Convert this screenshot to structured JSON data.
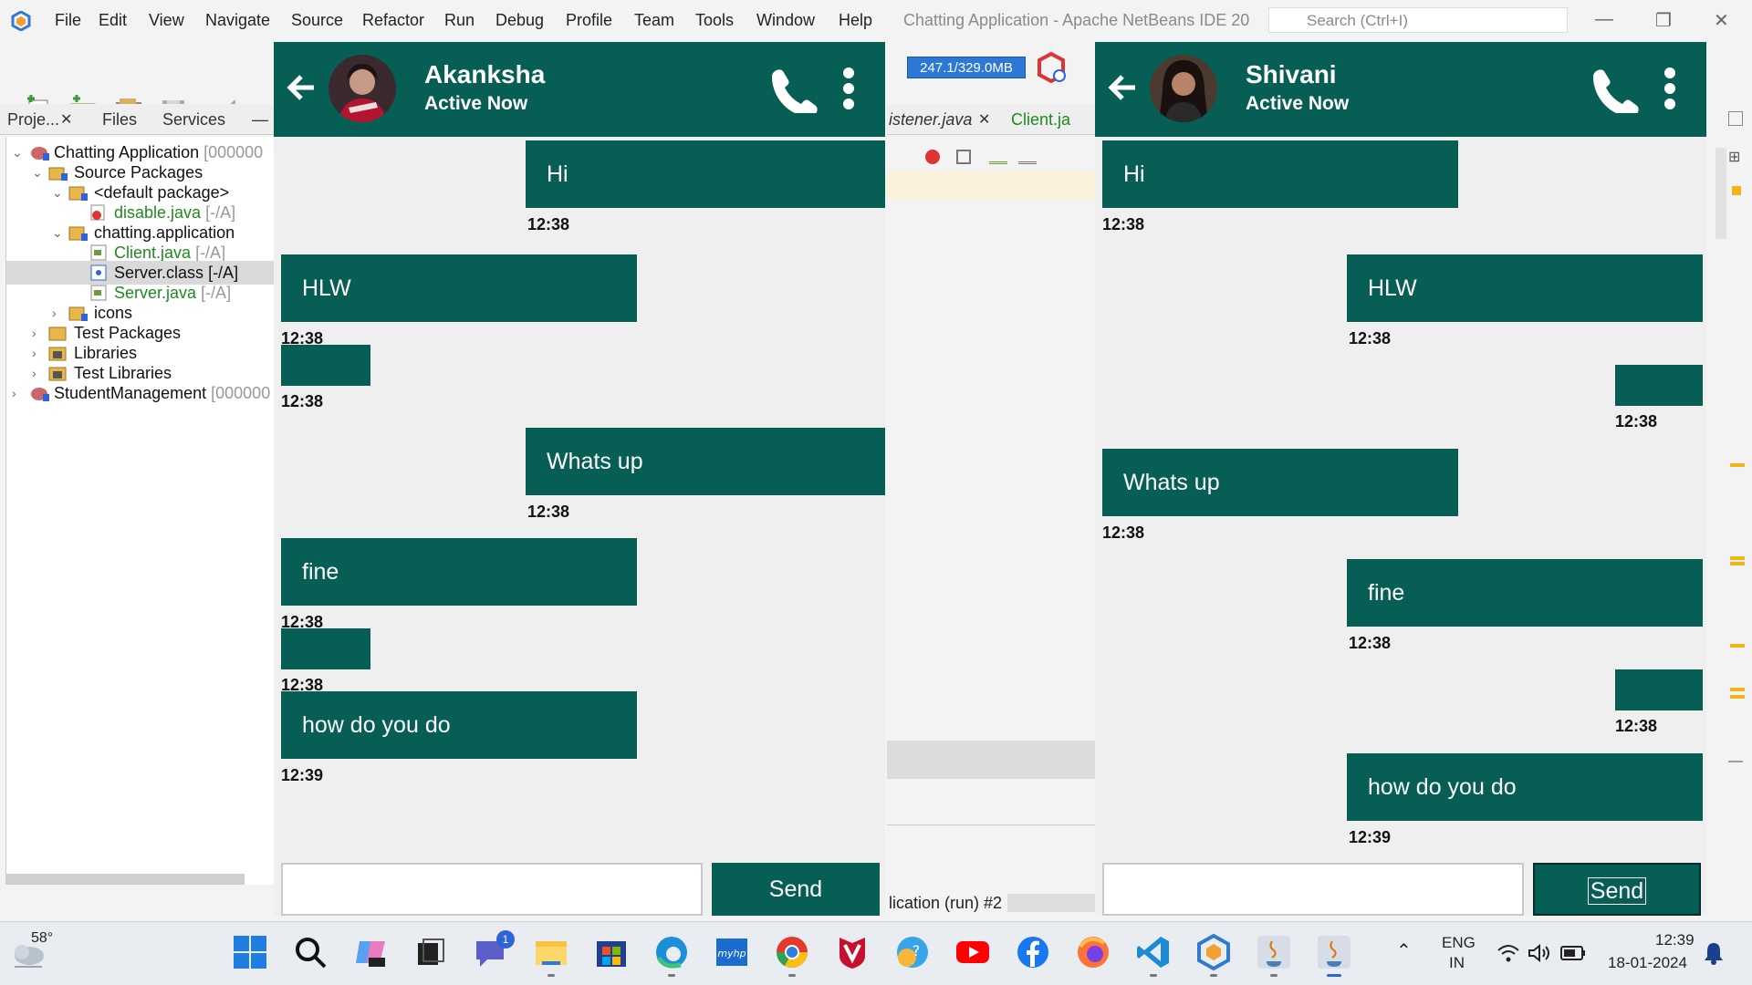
{
  "ide": {
    "title": "Chatting Application - Apache NetBeans IDE 20",
    "menu": [
      "File",
      "Edit",
      "View",
      "Navigate",
      "Source",
      "Refactor",
      "Run",
      "Debug",
      "Profile",
      "Team",
      "Tools",
      "Window",
      "Help"
    ],
    "search_placeholder": "Search (Ctrl+I)",
    "memory": "247.1/329.0MB",
    "panel_tabs": [
      "Proje...",
      "Files",
      "Services"
    ],
    "tree": [
      {
        "label": "Chatting Application",
        "suffix": "[000000",
        "level": 0
      },
      {
        "label": "Source Packages",
        "suffix": "",
        "level": 1
      },
      {
        "label": "<default package>",
        "suffix": "",
        "level": 2
      },
      {
        "label": "disable.java",
        "suffix": "[-/A]",
        "level": 3
      },
      {
        "label": "chatting.application",
        "suffix": "",
        "level": 2
      },
      {
        "label": "Client.java",
        "suffix": "[-/A]",
        "level": 3
      },
      {
        "label": "Server.class",
        "suffix": "[-/A]",
        "level": 3
      },
      {
        "label": "Server.java",
        "suffix": "[-/A]",
        "level": 3
      },
      {
        "label": "icons",
        "suffix": "",
        "level": 2
      },
      {
        "label": "Test Packages",
        "suffix": "",
        "level": 1
      },
      {
        "label": "Libraries",
        "suffix": "",
        "level": 1
      },
      {
        "label": "Test Libraries",
        "suffix": "",
        "level": 1
      },
      {
        "label": "StudentManagement",
        "suffix": "[000000",
        "level": 0
      }
    ],
    "editor_tabs": [
      "istener.java",
      "Client.ja"
    ],
    "output_tab": "lication (run) #2"
  },
  "chats": [
    {
      "name": "Akanksha",
      "status": "Active Now",
      "send_label": "Send",
      "messages": [
        {
          "text": "Hi",
          "time": "12:38"
        },
        {
          "text": "HLW",
          "time": "12:38"
        },
        {
          "text": "",
          "time": "12:38"
        },
        {
          "text": "Whats up",
          "time": "12:38"
        },
        {
          "text": "fine",
          "time": "12:38"
        },
        {
          "text": "",
          "time": "12:38"
        },
        {
          "text": "how do you do",
          "time": "12:39"
        }
      ]
    },
    {
      "name": "Shivani",
      "status": "Active Now",
      "send_label": "Send",
      "messages": [
        {
          "text": "Hi",
          "time": "12:38"
        },
        {
          "text": "HLW",
          "time": "12:38"
        },
        {
          "text": "",
          "time": "12:38"
        },
        {
          "text": "Whats up",
          "time": "12:38"
        },
        {
          "text": "fine",
          "time": "12:38"
        },
        {
          "text": "",
          "time": "12:38"
        },
        {
          "text": "how do you do",
          "time": "12:39"
        }
      ]
    }
  ],
  "taskbar": {
    "temperature": "58°",
    "teams_badge": "1",
    "lang_line1": "ENG",
    "lang_line2": "IN",
    "time": "12:39",
    "date": "18-01-2024"
  },
  "colors": {
    "chat_green": "#075e54",
    "chat_bg": "#efefef"
  }
}
